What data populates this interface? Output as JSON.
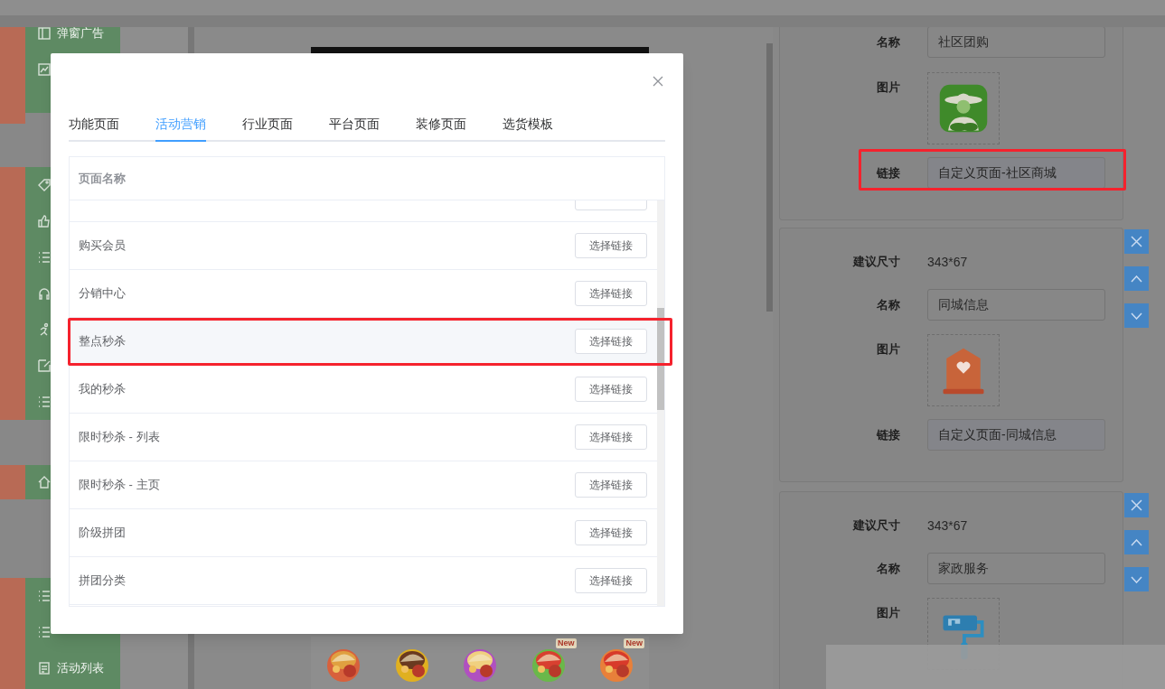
{
  "sidebar": {
    "items": [
      {
        "label": "弹窗广告"
      },
      {
        "label": "活动列表"
      }
    ]
  },
  "preview": {
    "icons": [
      {
        "kind": "picture"
      },
      {
        "kind": "picture"
      },
      {
        "kind": "picture"
      },
      {
        "kind": "picture",
        "badge": "New"
      },
      {
        "kind": "picture",
        "badge": "New"
      }
    ]
  },
  "cards": [
    {
      "name_label": "名称",
      "name": "社区团购",
      "image_label": "图片",
      "link_label": "链接",
      "link": "自定义页面-社区商城",
      "highlighted": true
    },
    {
      "size_label": "建议尺寸",
      "size": "343*67",
      "name_label": "名称",
      "name": "同城信息",
      "image_label": "图片",
      "link_label": "链接",
      "link": "自定义页面-同城信息",
      "highlighted": false
    },
    {
      "size_label": "建议尺寸",
      "size": "343*67",
      "name_label": "名称",
      "name": "家政服务",
      "image_label": "图片",
      "highlighted": false
    }
  ],
  "dialog": {
    "tabs": [
      {
        "label": "功能页面",
        "selected": false
      },
      {
        "label": "活动营销",
        "selected": true
      },
      {
        "label": "行业页面",
        "selected": false
      },
      {
        "label": "平台页面",
        "selected": false
      },
      {
        "label": "装修页面",
        "selected": false
      },
      {
        "label": "选货模板",
        "selected": false
      }
    ],
    "table": {
      "columns": [
        "页面名称"
      ],
      "rows": [
        {
          "name": "购买会员",
          "action": "选择链接",
          "highlighted": false
        },
        {
          "name": "分销中心",
          "action": "选择链接",
          "highlighted": false
        },
        {
          "name": "整点秒杀",
          "action": "选择链接",
          "highlighted": true
        },
        {
          "name": "我的秒杀",
          "action": "选择链接",
          "highlighted": false
        },
        {
          "name": "限时秒杀 - 列表",
          "action": "选择链接",
          "highlighted": false
        },
        {
          "name": "限时秒杀 - 主页",
          "action": "选择链接",
          "highlighted": false
        },
        {
          "name": "阶级拼团",
          "action": "选择链接",
          "highlighted": false
        },
        {
          "name": "拼团分类",
          "action": "选择链接",
          "highlighted": false
        }
      ]
    }
  }
}
